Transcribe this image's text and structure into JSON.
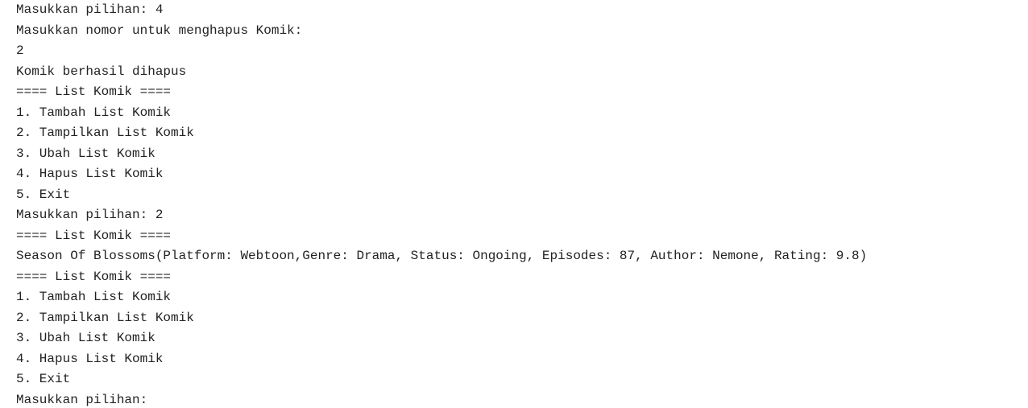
{
  "console": {
    "lines": [
      "Masukkan pilihan: 4",
      "Masukkan nomor untuk menghapus Komik:",
      "2",
      "Komik berhasil dihapus",
      "==== List Komik ====",
      "1. Tambah List Komik",
      "2. Tampilkan List Komik",
      "3. Ubah List Komik",
      "4. Hapus List Komik",
      "5. Exit",
      "Masukkan pilihan: 2",
      "==== List Komik ====",
      "Season Of Blossoms(Platform: Webtoon,Genre: Drama, Status: Ongoing, Episodes: 87, Author: Nemone, Rating: 9.8)",
      "==== List Komik ====",
      "1. Tambah List Komik",
      "2. Tampilkan List Komik",
      "3. Ubah List Komik",
      "4. Hapus List Komik",
      "5. Exit"
    ],
    "prompt": "Masukkan pilihan: "
  }
}
